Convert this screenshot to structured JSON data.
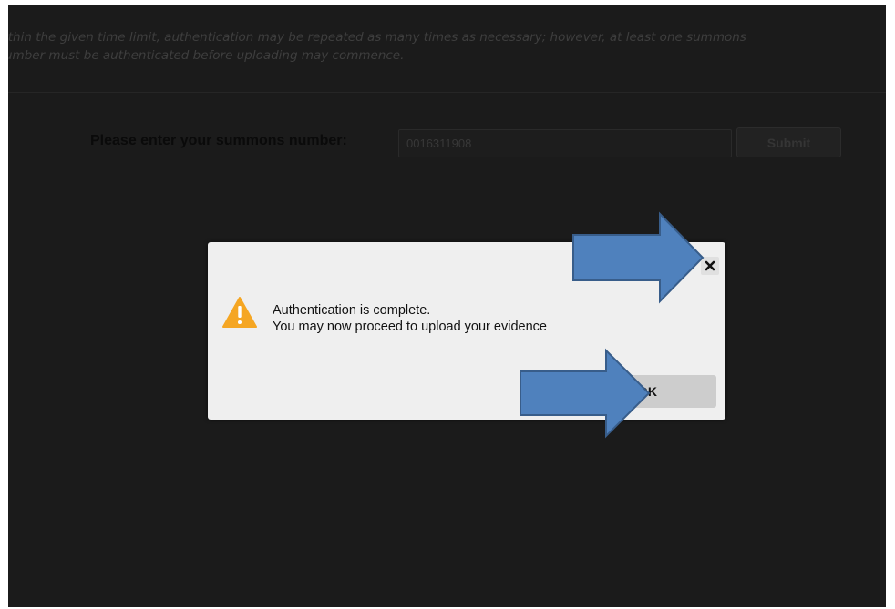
{
  "background_page": {
    "instructions_line1": "ithin the given time limit, authentication may be repeated as many times as necessary; however, at least one summons",
    "instructions_line2": "umber must be authenticated before uploading may commence.",
    "summons_label": "Please enter your summons number:",
    "summons_value": "0016311908",
    "submit_label": "Submit"
  },
  "dialog": {
    "icon": "warning-triangle-icon",
    "message_line1": "Authentication is complete.",
    "message_line2": "You may now proceed to upload your evidence",
    "ok_label": "OK",
    "close_icon": "close-icon"
  },
  "annotations": {
    "arrow_color": "#4f81bd",
    "arrow_border_color": "#385d8a",
    "arrows": [
      "arrow-to-close-button",
      "arrow-to-ok-button"
    ]
  },
  "colors": {
    "overlay_background": "#1b1b1b",
    "dialog_background": "#efefef",
    "warning_icon": "#f5a623",
    "ok_button": "#cdcdcd"
  }
}
